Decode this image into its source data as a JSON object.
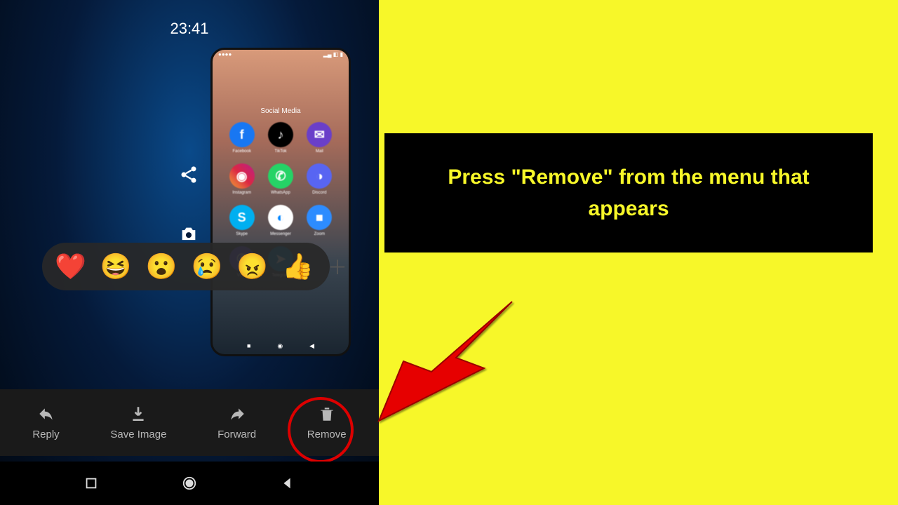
{
  "clock_time": "23:41",
  "folder_title": "Social Media",
  "apps": [
    {
      "name": "Facebook",
      "bg": "#1877f2",
      "letter": "f"
    },
    {
      "name": "TikTok",
      "bg": "#000000",
      "letter": "♪"
    },
    {
      "name": "Mail",
      "bg": "#6a3fc9",
      "letter": "✉"
    },
    {
      "name": "Instagram",
      "bg": "linear-gradient(45deg,#f09433,#e6683c,#dc2743,#cc2366,#bc1888)",
      "letter": "◉"
    },
    {
      "name": "WhatsApp",
      "bg": "#25d366",
      "letter": "✆"
    },
    {
      "name": "Discord",
      "bg": "#5865f2",
      "letter": "◑"
    },
    {
      "name": "Skype",
      "bg": "#00aff0",
      "letter": "S"
    },
    {
      "name": "Messenger",
      "bg": "#ffffff",
      "letter": "◐"
    },
    {
      "name": "Zoom",
      "bg": "#2d8cff",
      "letter": "■"
    },
    {
      "name": "Viber",
      "bg": "#7360f2",
      "letter": "✆"
    },
    {
      "name": "Telegram",
      "bg": "#0088cc",
      "letter": "➤"
    }
  ],
  "reactions": [
    "❤️",
    "😆",
    "😮",
    "😢",
    "😠",
    "👍"
  ],
  "actions": {
    "reply": "Reply",
    "save_image": "Save Image",
    "forward": "Forward",
    "remove": "Remove"
  },
  "instruction": "Press \"Remove\" from the menu that appears"
}
